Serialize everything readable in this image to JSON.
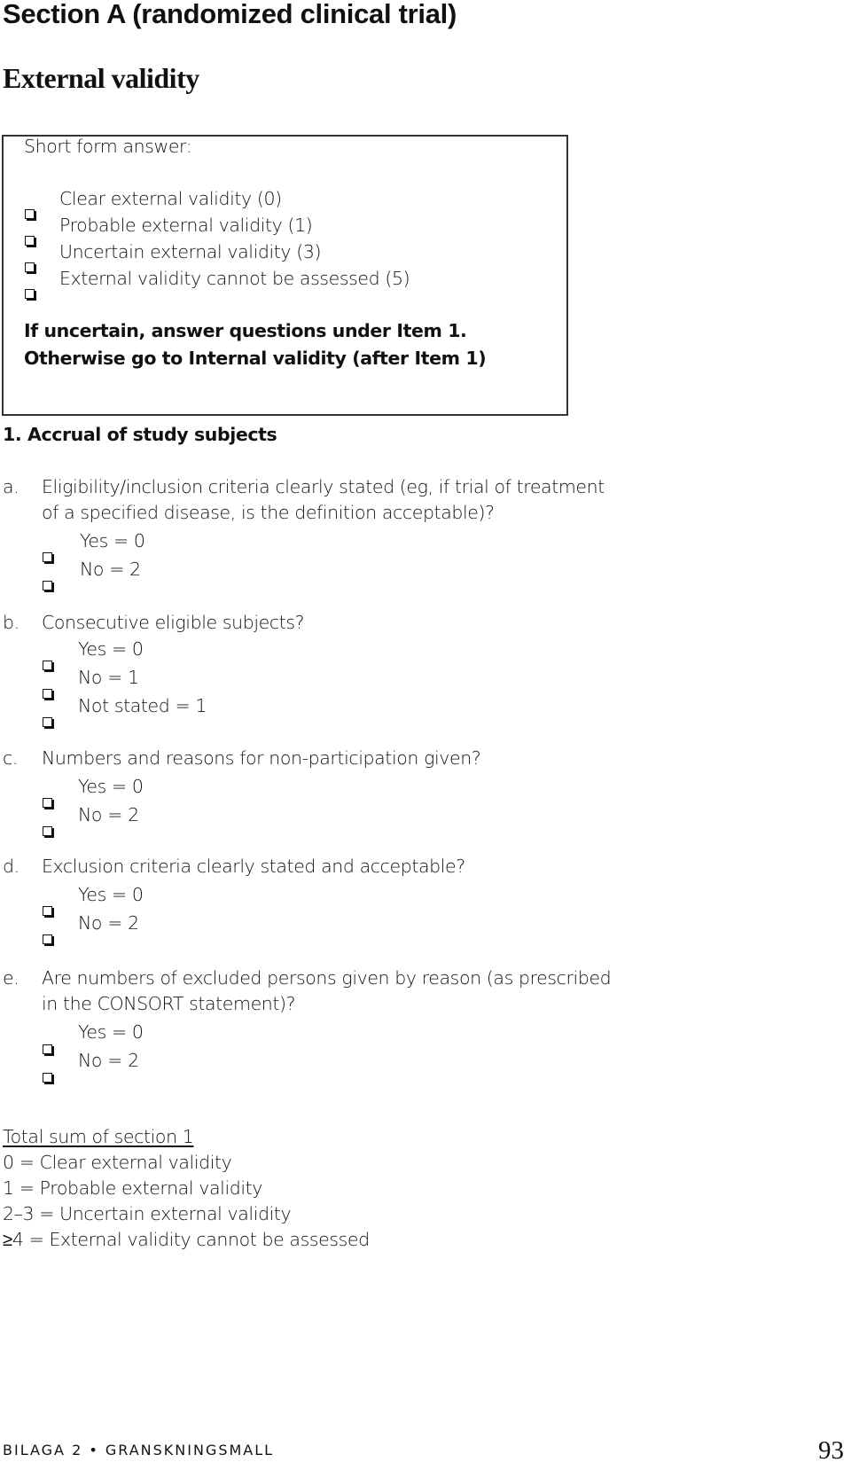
{
  "page": {
    "section_title": "Section A (randomized clinical trial)",
    "subsection_title": "External validity"
  },
  "short_form": {
    "label": "Short form answer:",
    "options": [
      "Clear external validity (0)",
      "Probable external validity (1)",
      "Uncertain external validity (3)",
      "External validity cannot be assessed (5)"
    ],
    "instruction_line1": "If uncertain, answer questions under Item 1.",
    "instruction_line2": "Otherwise go to Internal validity (after Item 1)"
  },
  "item1": {
    "heading": "1. Accrual of study subjects",
    "questions": [
      {
        "letter": "a.",
        "lines": [
          "Eligibility/inclusion criteria clearly stated (eg, if trial of treatment",
          "of a specified disease, is the definition acceptable)?"
        ],
        "options": [
          "Yes = 0",
          "No = 2"
        ]
      },
      {
        "letter": "b.",
        "lines": [
          "Consecutive eligible subjects?"
        ],
        "options": [
          "Yes = 0",
          "No = 1",
          "Not stated = 1"
        ]
      },
      {
        "letter": "c.",
        "lines": [
          "Numbers and reasons for non-participation given?"
        ],
        "options": [
          "Yes = 0",
          "No = 2"
        ]
      },
      {
        "letter": "d.",
        "lines": [
          "Exclusion criteria clearly stated and acceptable?"
        ],
        "options": [
          "Yes = 0",
          "No = 2"
        ]
      },
      {
        "letter": "e.",
        "lines": [
          "Are numbers of excluded persons given by reason (as prescribed",
          "in the CONSORT statement)?"
        ],
        "options": [
          "Yes = 0",
          "No = 2"
        ]
      }
    ]
  },
  "total": {
    "heading": "Total sum of section 1",
    "lines": [
      "0 = Clear external validity",
      "1 = Probable external validity",
      "2–3 = Uncertain external validity",
      "≥4 = External validity cannot be assessed"
    ]
  },
  "footer": {
    "text": "BILAGA 2 • GRANSKNINGSMALL",
    "page_number": "93"
  }
}
